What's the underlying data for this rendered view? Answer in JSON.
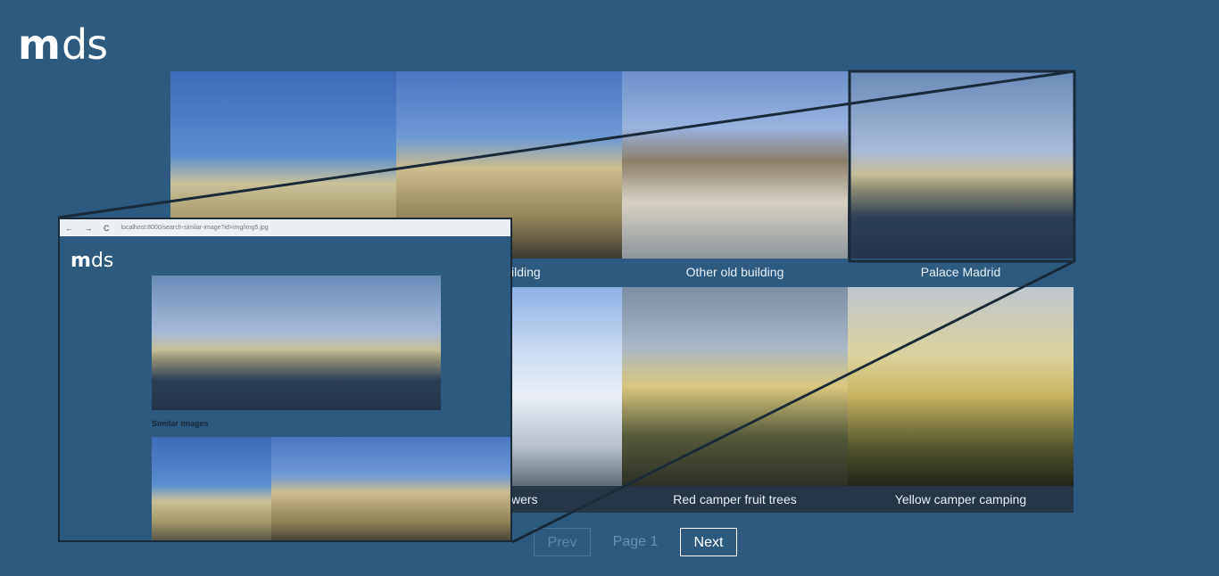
{
  "logo": {
    "bold_part": "m",
    "rest": "ds"
  },
  "gallery": {
    "tiles": [
      {
        "caption": ""
      },
      {
        "caption": ""
      },
      {
        "caption": "Other old building"
      },
      {
        "caption": "Palace Madrid"
      },
      {
        "caption": "wers"
      },
      {
        "caption": "Red camper fruit trees"
      },
      {
        "caption": "Yellow camper camping"
      }
    ],
    "partial_caption_row1": "ilding"
  },
  "pagination": {
    "prev_label": "Prev",
    "page_label": "Page 1",
    "next_label": "Next"
  },
  "inset": {
    "browser_nav": "← → C",
    "url": "localhost:8000/search-similar-image?id=img/img5.jpg",
    "logo_bold": "m",
    "logo_rest": "ds",
    "similar_label": "Similar images"
  },
  "colors": {
    "background": "#2f5a80",
    "caption_dark": "#263646",
    "frame": "#1a2a38"
  }
}
